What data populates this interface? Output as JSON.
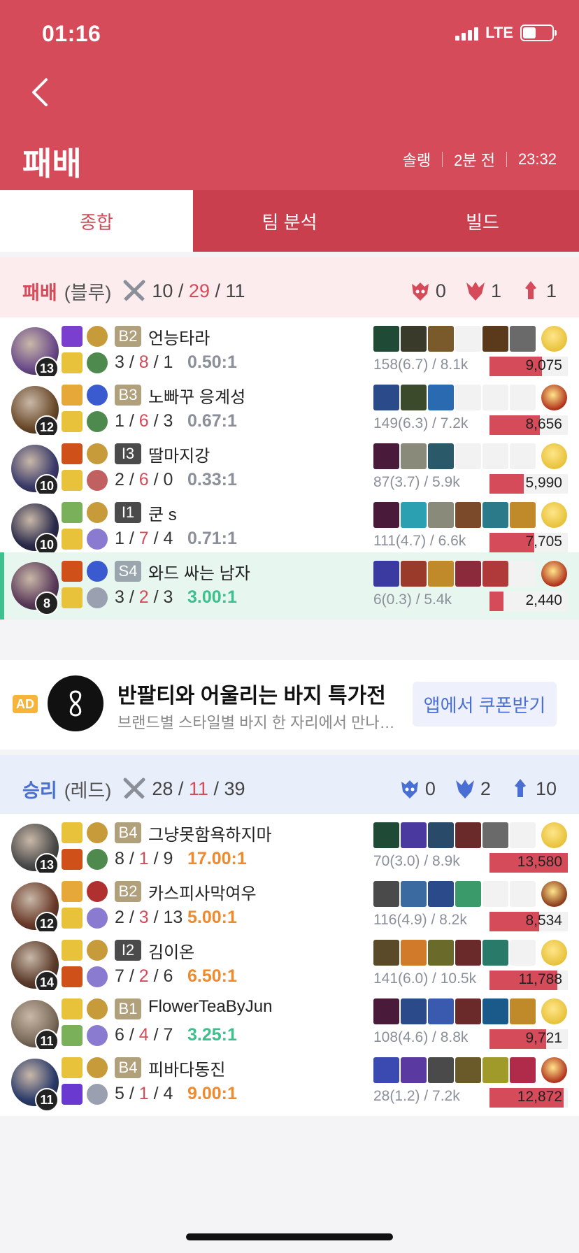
{
  "status_bar": {
    "time": "01:16",
    "network": "LTE"
  },
  "header": {
    "title": "패배",
    "queue": "솔랭",
    "ago": "2분 전",
    "duration": "23:32"
  },
  "tabs": [
    {
      "label": "종합",
      "active": true
    },
    {
      "label": "팀 분석",
      "active": false
    },
    {
      "label": "빌드",
      "active": false
    }
  ],
  "teams": [
    {
      "result": "패배",
      "side": "(블루)",
      "kills": "10",
      "deaths": "29",
      "assists": "11",
      "objectives": [
        {
          "icon": "baron-icon",
          "count": "0"
        },
        {
          "icon": "dragon-icon",
          "count": "1"
        },
        {
          "icon": "tower-icon",
          "count": "1"
        }
      ],
      "players": [
        {
          "level": "13",
          "tier": "B2",
          "tier_color": "bronze",
          "name": "언능타라",
          "k": "3",
          "d": "8",
          "a": "1",
          "ratio": "0.50:1",
          "ratio_class": "",
          "cs": "158(6.7) / 8.1k",
          "damage": "9,075",
          "damage_value": 9075,
          "items": [
            "#1e4a36",
            "#3a3a2a",
            "#7a5a2a",
            "",
            "#5a3a1a",
            "#6a6a6a"
          ],
          "trinket": "#e7c23a",
          "champ": "#6b4b8a",
          "sp": [
            "#7a3fcf",
            "#e7c23a"
          ],
          "runes": [
            "#c79a3a",
            "#4e8a4e"
          ]
        },
        {
          "level": "12",
          "tier": "B3",
          "tier_color": "bronze",
          "name": "노빠꾸 응계성",
          "k": "1",
          "d": "6",
          "a": "3",
          "ratio": "0.67:1",
          "ratio_class": "",
          "cs": "149(6.3) / 7.2k",
          "damage": "8,656",
          "damage_value": 8656,
          "items": [
            "#2a4a8a",
            "#3a4a2a",
            "#2a6ab0",
            "",
            "",
            ""
          ],
          "trinket": "#b0301a",
          "champ": "#6a4a2a",
          "sp": [
            "#e7a83a",
            "#e7c23a"
          ],
          "runes": [
            "#3a5ad0",
            "#4e8a4e"
          ]
        },
        {
          "level": "10",
          "tier": "I3",
          "tier_color": "iron",
          "name": "딸마지강",
          "k": "2",
          "d": "6",
          "a": "0",
          "ratio": "0.33:1",
          "ratio_class": "",
          "cs": "87(3.7) / 5.9k",
          "damage": "5,990",
          "damage_value": 5990,
          "items": [
            "#4a1a3a",
            "#8a8a7a",
            "#2a5a6a",
            "",
            "",
            ""
          ],
          "trinket": "#e7c23a",
          "champ": "#3a3a6a",
          "sp": [
            "#d0501a",
            "#e7c23a"
          ],
          "runes": [
            "#c79a3a",
            "#c06060"
          ]
        },
        {
          "level": "10",
          "tier": "I1",
          "tier_color": "iron",
          "name": "쿤 s",
          "k": "1",
          "d": "7",
          "a": "4",
          "ratio": "0.71:1",
          "ratio_class": "",
          "cs": "111(4.7) / 6.6k",
          "damage": "7,705",
          "damage_value": 7705,
          "items": [
            "#4a1a3a",
            "#2aa0b0",
            "#8a8a7a",
            "#7a4a2a",
            "#2a7a8a",
            "#c08a2a"
          ],
          "trinket": "#e7c23a",
          "champ": "#2a2a4a",
          "sp": [
            "#7ab05a",
            "#e7c23a"
          ],
          "runes": [
            "#c79a3a",
            "#8a7ad0"
          ]
        },
        {
          "level": "8",
          "tier": "S4",
          "tier_color": "silver",
          "name": "와드 싸는 남자",
          "k": "3",
          "d": "2",
          "a": "3",
          "ratio": "3.00:1",
          "ratio_class": "good",
          "cs": "6(0.3) / 5.4k",
          "damage": "2,440",
          "damage_value": 2440,
          "me": true,
          "items": [
            "#3a3aa0",
            "#9a3a2a",
            "#c08a2a",
            "#8a2a3a",
            "#b03a3a",
            ""
          ],
          "trinket": "#b0301a",
          "champ": "#5a3a5a",
          "sp": [
            "#d0501a",
            "#e7c23a"
          ],
          "runes": [
            "#3a5ad0",
            "#9aa0b0"
          ]
        }
      ]
    },
    {
      "result": "승리",
      "side": "(레드)",
      "kills": "28",
      "deaths": "11",
      "assists": "39",
      "objectives": [
        {
          "icon": "baron-icon",
          "count": "0"
        },
        {
          "icon": "dragon-icon",
          "count": "2"
        },
        {
          "icon": "tower-icon",
          "count": "10"
        }
      ],
      "players": [
        {
          "level": "13",
          "tier": "B4",
          "tier_color": "bronze",
          "name": "그냥못함욕하지마",
          "k": "8",
          "d": "1",
          "a": "9",
          "ratio": "17.00:1",
          "ratio_class": "great",
          "cs": "70(3.0) / 8.9k",
          "damage": "13,580",
          "damage_value": 13580,
          "items": [
            "#1e4a36",
            "#4a3aa0",
            "#2a4a6a",
            "#6a2a2a",
            "#6a6a6a",
            ""
          ],
          "trinket": "#e7c23a",
          "champ": "#4a4a4a",
          "sp": [
            "#e7c23a",
            "#d0501a"
          ],
          "runes": [
            "#c79a3a",
            "#4e8a4e"
          ]
        },
        {
          "level": "12",
          "tier": "B2",
          "tier_color": "bronze",
          "name": "카스피사막여우",
          "k": "2",
          "d": "3",
          "a": "13",
          "ratio": "5.00:1",
          "ratio_class": "great",
          "cs": "116(4.9) / 8.2k",
          "damage": "8,534",
          "damage_value": 8534,
          "items": [
            "#4a4a4a",
            "#3a6aa0",
            "#2a4a8a",
            "#3a9a6a",
            "",
            ""
          ],
          "trinket": "#8a3a1a",
          "champ": "#6a3a2a",
          "sp": [
            "#e7a83a",
            "#e7c23a"
          ],
          "runes": [
            "#b03030",
            "#8a7ad0"
          ]
        },
        {
          "level": "14",
          "tier": "I2",
          "tier_color": "iron",
          "name": "김이온",
          "k": "7",
          "d": "2",
          "a": "6",
          "ratio": "6.50:1",
          "ratio_class": "great",
          "cs": "141(6.0) / 10.5k",
          "damage": "11,788",
          "damage_value": 11788,
          "items": [
            "#5a4a2a",
            "#d07a2a",
            "#6a6a2a",
            "#6a2a2a",
            "#2a7a6a",
            ""
          ],
          "trinket": "#e7c23a",
          "champ": "#5a3a2a",
          "sp": [
            "#e7c23a",
            "#d0501a"
          ],
          "runes": [
            "#c79a3a",
            "#8a7ad0"
          ]
        },
        {
          "level": "11",
          "tier": "B1",
          "tier_color": "bronze",
          "name": "FlowerTeaByJun",
          "k": "6",
          "d": "4",
          "a": "7",
          "ratio": "3.25:1",
          "ratio_class": "good",
          "cs": "108(4.6) / 8.8k",
          "damage": "9,721",
          "damage_value": 9721,
          "items": [
            "#4a1a3a",
            "#2a4a8a",
            "#3a5ab0",
            "#6a2a2a",
            "#1a5a8a",
            "#c08a2a"
          ],
          "trinket": "#e7c23a",
          "champ": "#7a6a5a",
          "sp": [
            "#e7c23a",
            "#7ab05a"
          ],
          "runes": [
            "#c79a3a",
            "#8a7ad0"
          ]
        },
        {
          "level": "11",
          "tier": "B4",
          "tier_color": "bronze",
          "name": "피바다동진",
          "k": "5",
          "d": "1",
          "a": "4",
          "ratio": "9.00:1",
          "ratio_class": "great",
          "cs": "28(1.2) / 7.2k",
          "damage": "12,872",
          "damage_value": 12872,
          "items": [
            "#3a4ab0",
            "#5a3aa0",
            "#4a4a4a",
            "#6a5a2a",
            "#a09a2a",
            "#b02a4a"
          ],
          "trinket": "#b0301a",
          "champ": "#2a3a6a",
          "sp": [
            "#e7c23a",
            "#6a3ad0"
          ],
          "runes": [
            "#c79a3a",
            "#9aa0b0"
          ]
        }
      ]
    }
  ],
  "max_damage": 13580,
  "ad": {
    "badge": "AD",
    "title": "반팔티와 어울리는 바지 특가전",
    "subtitle": "브랜드별 스타일별 바지 한 자리에서 만나보세요",
    "cta": "앱에서 쿠폰받기"
  }
}
